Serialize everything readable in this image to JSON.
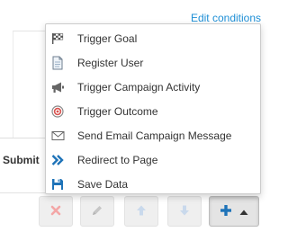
{
  "header": {
    "edit_conditions_link": "Edit conditions"
  },
  "form": {
    "submit_label": "Submit"
  },
  "dropdown_menu": {
    "items": [
      {
        "label": "Trigger Goal",
        "icon": "checkered-flag-icon"
      },
      {
        "label": "Register User",
        "icon": "document-icon"
      },
      {
        "label": "Trigger Campaign Activity",
        "icon": "megaphone-icon"
      },
      {
        "label": "Trigger Outcome",
        "icon": "target-icon"
      },
      {
        "label": "Send Email Campaign Message",
        "icon": "envelope-icon"
      },
      {
        "label": "Redirect to Page",
        "icon": "double-chevron-right-icon"
      },
      {
        "label": "Save Data",
        "icon": "floppy-disk-icon"
      }
    ]
  },
  "toolbar": {
    "buttons": [
      {
        "name": "delete-button",
        "icon": "x-icon",
        "color": "#f4a6a6"
      },
      {
        "name": "edit-button",
        "icon": "pencil-icon",
        "color": "#c6c6c6"
      },
      {
        "name": "move-up-button",
        "icon": "arrow-up-icon",
        "color": "#c9d9ec"
      },
      {
        "name": "move-down-button",
        "icon": "arrow-down-icon",
        "color": "#c9d9ec"
      },
      {
        "name": "add-action-button",
        "icon": "plus-icon",
        "color": "#1e73b8"
      }
    ]
  },
  "colors": {
    "link": "#1e8fd6",
    "icon_blue": "#1e73b8",
    "target_red": "#d9534f",
    "icon_gray": "#666666"
  }
}
